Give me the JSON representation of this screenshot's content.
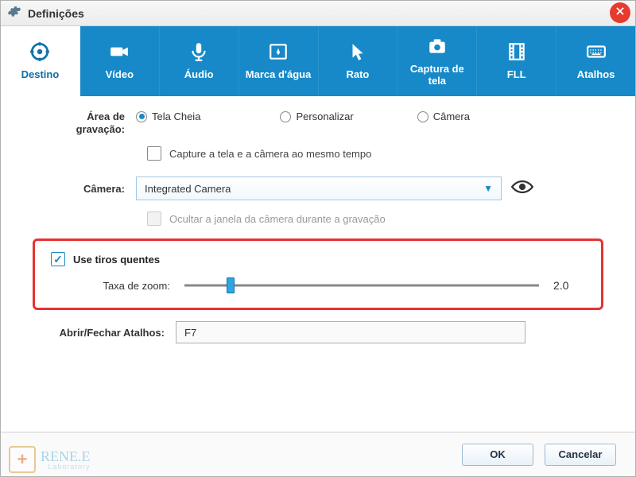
{
  "window": {
    "title": "Definições"
  },
  "tabs": [
    {
      "label": "Destino"
    },
    {
      "label": "Vídeo"
    },
    {
      "label": "Áudio"
    },
    {
      "label": "Marca d'água"
    },
    {
      "label": "Rato"
    },
    {
      "label": "Captura de\ntela"
    },
    {
      "label": "FLL"
    },
    {
      "label": "Atalhos"
    }
  ],
  "recording_area": {
    "label": "Área de gravação:",
    "options": {
      "fullscreen": "Tela Cheia",
      "custom": "Personalizar",
      "camera": "Câmera"
    },
    "selected": "fullscreen",
    "capture_both": {
      "label": "Capture a tela e a câmera ao mesmo tempo",
      "checked": false
    }
  },
  "camera": {
    "label": "Câmera:",
    "selected": "Integrated Camera",
    "hide_window": {
      "label": "Ocultar a janela da câmera durante a gravação",
      "checked": false,
      "enabled": false
    }
  },
  "hotshots": {
    "label": "Use tiros quentes",
    "checked": true,
    "zoom_label": "Taxa de zoom:",
    "zoom_value": "2.0",
    "zoom_percent": 13
  },
  "shortcut": {
    "label": "Abrir/Fechar Atalhos:",
    "value": "F7"
  },
  "footer": {
    "ok": "OK",
    "cancel": "Cancelar"
  },
  "watermark": {
    "line1": "RENE.E",
    "line2": "Laboratory"
  }
}
